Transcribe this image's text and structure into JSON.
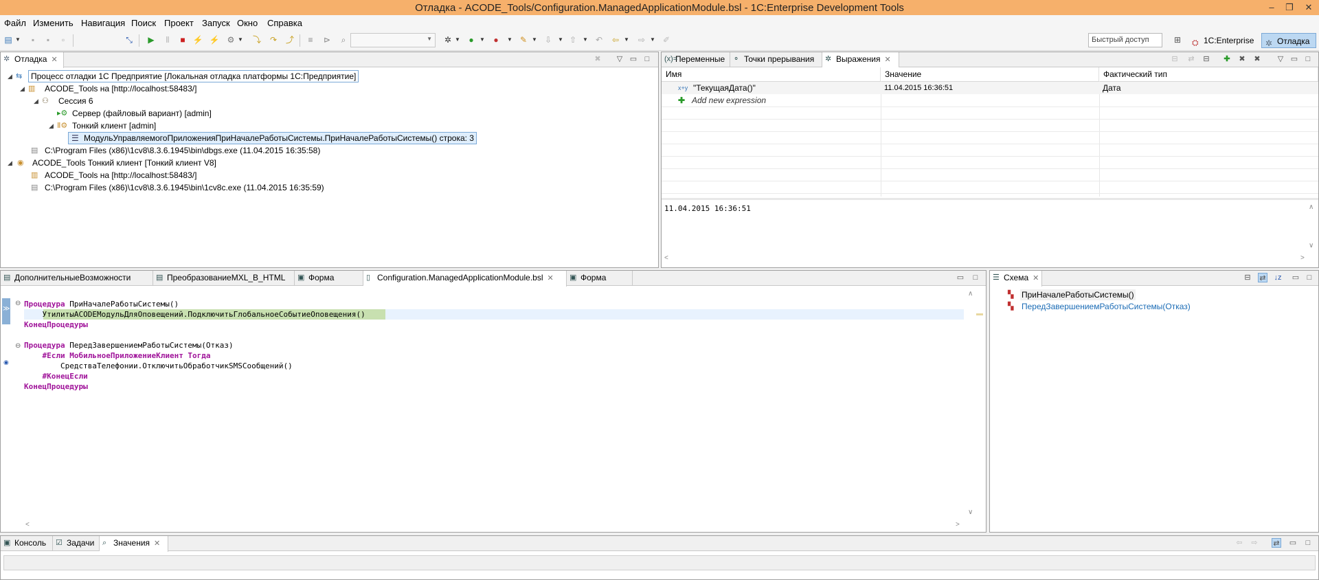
{
  "window": {
    "title": "Отладка - ACODE_Tools/Configuration.ManagedApplicationModule.bsl - 1C:Enterprise Development Tools",
    "minimize": "–",
    "restore": "❐",
    "close": "✕"
  },
  "menu": [
    "Файл",
    "Изменить",
    "Навигация",
    "Поиск",
    "Проект",
    "Запуск",
    "Окно",
    "Справка"
  ],
  "toolbar": {
    "quick_access_placeholder": "Быстрый доступ",
    "perspectives": [
      {
        "label": "1C:Enterprise",
        "icon": "1c-perspective-icon"
      },
      {
        "label": "Отладка",
        "icon": "debug-perspective-icon",
        "active": true
      }
    ]
  },
  "debug_view": {
    "tab": "Отладка",
    "tree": [
      {
        "label": "Процесс отладки 1С Предприятие [Локальная отладка платформы 1С:Предприятие]",
        "level": 0,
        "icon": "debug-launch-icon",
        "selected_frame": true
      },
      {
        "label": "ACODE_Tools на [http://localhost:58483/]",
        "level": 1,
        "icon": "infobase-icon"
      },
      {
        "label": "Сессия 6",
        "level": 2,
        "icon": "session-icon"
      },
      {
        "label": "Сервер (файловый вариант) [admin]",
        "level": 3,
        "icon": "server-icon"
      },
      {
        "label": "Тонкий клиент [admin]",
        "level": 3,
        "icon": "client-icon"
      },
      {
        "label": "МодульУправляемогоПриложенияПриНачалеРаботыСистемы.ПриНачалеРаботыСистемы() строка: 3",
        "level": 4,
        "icon": "stack-frame-icon",
        "selected": true
      },
      {
        "label": "C:\\Program Files (x86)\\1cv8\\8.3.6.1945\\bin\\dbgs.exe (11.04.2015 16:35:58)",
        "level": 1,
        "icon": "process-icon"
      },
      {
        "label": "ACODE_Tools Тонкий клиент [Тонкий клиент V8]",
        "level": 0,
        "icon": "launch-icon"
      },
      {
        "label": "ACODE_Tools на [http://localhost:58483/]",
        "level": 1,
        "icon": "infobase-icon"
      },
      {
        "label": "C:\\Program Files (x86)\\1cv8\\8.3.6.1945\\bin\\1cv8c.exe (11.04.2015 16:35:59)",
        "level": 1,
        "icon": "process-icon"
      }
    ]
  },
  "variables_view": {
    "tabs": [
      "Переменные",
      "Точки прерывания",
      "Выражения"
    ],
    "active_tab": "Выражения",
    "columns": [
      "Имя",
      "Значение",
      "Фактический тип"
    ],
    "rows": [
      {
        "name": "\"ТекущаяДата()\"",
        "value": "11.04.2015 16:36:51",
        "type": "Дата"
      }
    ],
    "add_expression": "Add new expression",
    "detail": "11.04.2015 16:36:51"
  },
  "editor": {
    "tabs": [
      "ДополнительныеВозможности",
      "ПреобразованиеMXL_В_HTML",
      "Форма",
      "Configuration.ManagedApplicationModule.bsl",
      "Форма"
    ],
    "active_tab": "Configuration.ManagedApplicationModule.bsl",
    "lines": [
      {
        "kw": "Процедура",
        "text": " ПриНачалеРаботыСистемы()"
      },
      {
        "indent": "    ",
        "text": "УтилитыACODEМодульДляОповещений.ПодключитьГлобальноеСобытиеОповещения()"
      },
      {
        "kw": "КонецПроцедуры",
        "text": ""
      },
      {
        "text": ""
      },
      {
        "kw": "Процедура",
        "text": " ПередЗавершениемРаботыСистемы(Отказ)"
      },
      {
        "indent": "    ",
        "kw": "#Если",
        "text": " МобильноеПриложениеКлиент Тогда"
      },
      {
        "indent": "        ",
        "text": "СредстваТелефонии.ОтключитьОбработчикSMSСообщений()"
      },
      {
        "indent": "    ",
        "kw": "#КонецЕсли",
        "text": ""
      },
      {
        "kw": "КонецПроцедуры",
        "text": ""
      }
    ]
  },
  "outline": {
    "tab": "Схема",
    "items": [
      {
        "label": "ПриНачалеРаботыСистемы()",
        "color": "#000000"
      },
      {
        "label": "ПередЗавершениемРаботыСистемы(Отказ)",
        "color": "#1a6bb5"
      }
    ]
  },
  "bottom": {
    "tabs": [
      "Консоль",
      "Задачи",
      "Значения"
    ],
    "active_tab": "Значения"
  }
}
